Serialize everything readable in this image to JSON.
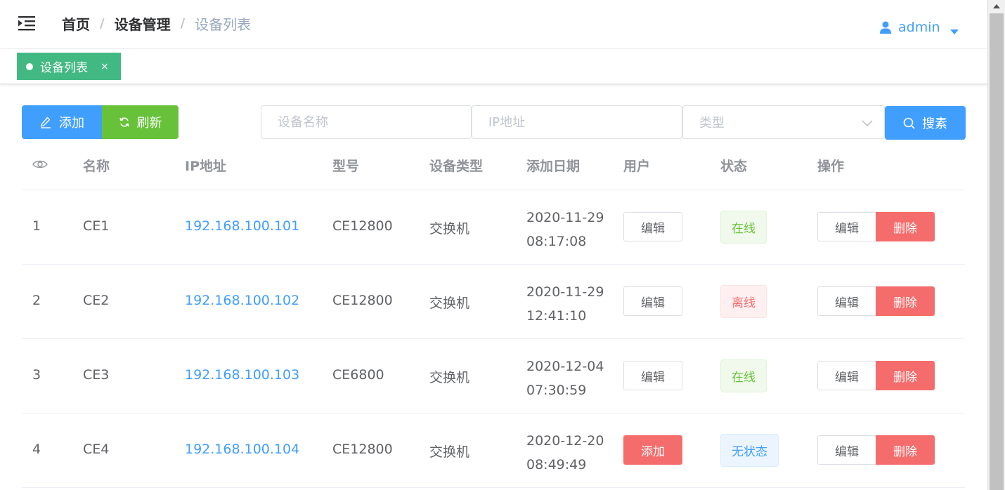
{
  "breadcrumb": {
    "home": "首页",
    "section": "设备管理",
    "current": "设备列表",
    "sep": "/"
  },
  "user": {
    "name": "admin"
  },
  "tags": {
    "active_label": "设备列表",
    "close": "×"
  },
  "toolbar": {
    "add_label": "添加",
    "refresh_label": "刷新",
    "name_placeholder": "设备名称",
    "ip_placeholder": "IP地址",
    "type_placeholder": "类型",
    "search_label": "搜素"
  },
  "table": {
    "headers": [
      "名称",
      "IP地址",
      "型号",
      "设备类型",
      "添加日期",
      "用户",
      "状态",
      "操作"
    ],
    "rows": [
      {
        "index": "1",
        "name": "CE1",
        "ip": "192.168.100.101",
        "model": "CE12800",
        "type": "交换机",
        "date": "2020-11-29",
        "time": "08:17:08",
        "user_action": "编辑",
        "status": "在线",
        "op_edit": "编辑",
        "op_delete": "删除"
      },
      {
        "index": "2",
        "name": "CE2",
        "ip": "192.168.100.102",
        "model": "CE12800",
        "type": "交换机",
        "date": "2020-11-29",
        "time": "12:41:10",
        "user_action": "编辑",
        "status": "离线",
        "op_edit": "编辑",
        "op_delete": "删除"
      },
      {
        "index": "3",
        "name": "CE3",
        "ip": "192.168.100.103",
        "model": "CE6800",
        "type": "交换机",
        "date": "2020-12-04",
        "time": "07:30:59",
        "user_action": "编辑",
        "status": "在线",
        "op_edit": "编辑",
        "op_delete": "删除"
      },
      {
        "index": "4",
        "name": "CE4",
        "ip": "192.168.100.104",
        "model": "CE12800",
        "type": "交换机",
        "date": "2020-12-20",
        "time": "08:49:49",
        "user_action": "添加",
        "status": "无状态",
        "op_edit": "编辑",
        "op_delete": "删除"
      }
    ]
  },
  "colors": {
    "primary": "#409eff",
    "success": "#67c23a",
    "danger": "#f56c6c",
    "tag": "#42b983"
  }
}
